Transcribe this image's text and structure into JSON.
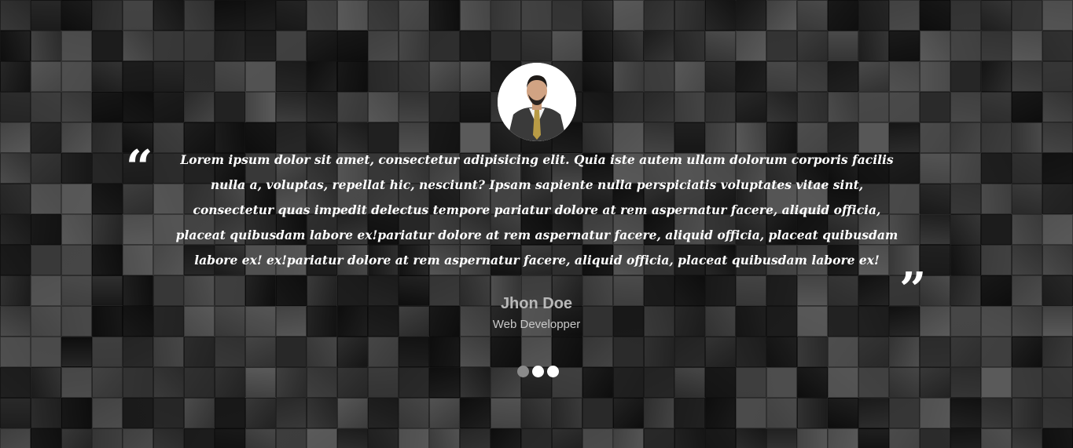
{
  "testimonial": {
    "quote": "Lorem ipsum dolor sit amet, consectetur adipisicing elit. Quia iste autem ullam dolorum corporis facilis nulla a, voluptas, repellat hic, nesciunt? Ipsam sapiente nulla perspiciatis voluptates vitae sint, consectetur quas impedit delectus tempore pariatur dolore at rem aspernatur facere, aliquid officia, placeat quibusdam labore ex!pariatur dolore at rem aspernatur facere, aliquid officia, placeat quibusdam labore ex! ex!pariatur dolore at rem aspernatur facere, aliquid officia, placeat quibusdam labore ex!",
    "open_quote_glyph": "“",
    "close_quote_glyph": "”",
    "author_name": "Jhon Doe",
    "author_role": "Web Developper",
    "avatar_icon": "person-photo-icon"
  },
  "carousel": {
    "dots": [
      {
        "active": false
      },
      {
        "active": true
      },
      {
        "active": true
      }
    ]
  },
  "colors": {
    "text": "#ffffff",
    "author_name": "#b9b9b9",
    "dot_inactive": "#8a8a8a",
    "dot_active": "#ffffff"
  }
}
